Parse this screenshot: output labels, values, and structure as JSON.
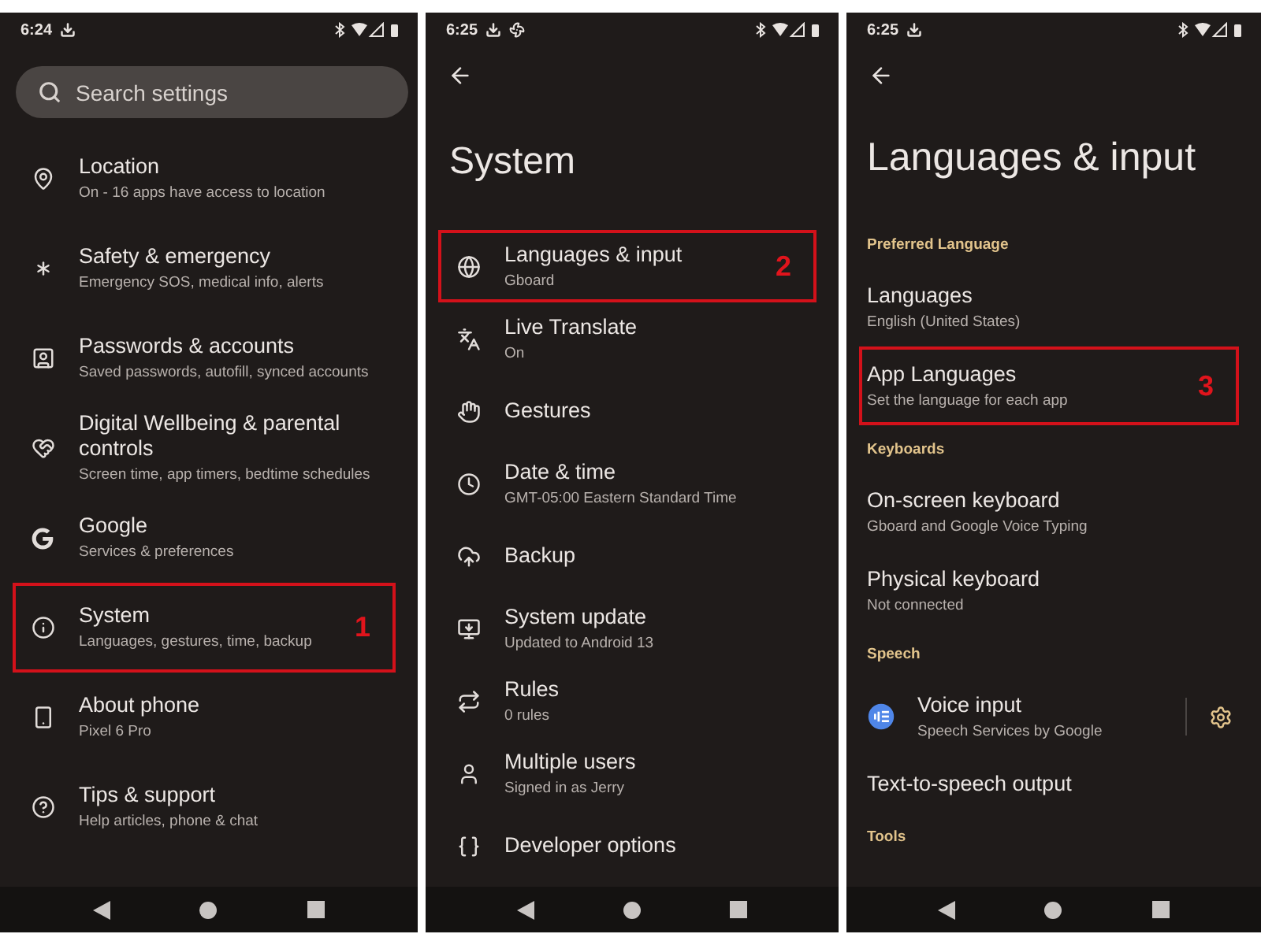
{
  "panels": [
    {
      "status_bar": {
        "time": "6:24",
        "notifications": [
          {
            "kind": "download"
          }
        ]
      },
      "search": {
        "placeholder": "Search settings"
      },
      "items": [
        {
          "kind": "entry",
          "title": "Location",
          "subtitle": "On - 16 apps have access to location"
        },
        {
          "kind": "entry",
          "title": "Safety & emergency",
          "subtitle": "Emergency SOS, medical info, alerts"
        },
        {
          "kind": "entry",
          "title": "Passwords & accounts",
          "subtitle": "Saved passwords, autofill, synced accounts"
        },
        {
          "kind": "entry",
          "title": "Digital Wellbeing & parental controls",
          "subtitle": "Screen time, app timers, bedtime schedules"
        },
        {
          "kind": "entry",
          "title": "Google",
          "subtitle": "Services & preferences"
        },
        {
          "kind": "entry",
          "title": "System",
          "subtitle": "Languages, gestures, time, backup",
          "callout": "1"
        },
        {
          "kind": "entry",
          "title": "About phone",
          "subtitle": "Pixel 6 Pro"
        },
        {
          "kind": "entry",
          "title": "Tips & support",
          "subtitle": "Help articles, phone & chat"
        }
      ]
    },
    {
      "status_bar": {
        "time": "6:25",
        "notifications": [
          {
            "kind": "download"
          },
          {
            "kind": "fan"
          }
        ]
      },
      "title": "System",
      "items": [
        {
          "kind": "entry",
          "title": "Languages & input",
          "subtitle": "Gboard",
          "callout": "2"
        },
        {
          "kind": "entry",
          "title": "Live Translate",
          "subtitle": "On"
        },
        {
          "kind": "entry",
          "title": "Gestures"
        },
        {
          "kind": "entry",
          "title": "Date & time",
          "subtitle": "GMT-05:00 Eastern Standard Time"
        },
        {
          "kind": "entry",
          "title": "Backup"
        },
        {
          "kind": "entry",
          "title": "System update",
          "subtitle": "Updated to Android 13"
        },
        {
          "kind": "entry",
          "title": "Rules",
          "subtitle": "0 rules"
        },
        {
          "kind": "entry",
          "title": "Multiple users",
          "subtitle": "Signed in as Jerry"
        },
        {
          "kind": "entry",
          "title": "Developer options"
        }
      ]
    },
    {
      "status_bar": {
        "time": "6:25",
        "notifications": [
          {
            "kind": "download"
          }
        ]
      },
      "title": "Languages & input",
      "items": [
        {
          "kind": "section",
          "title": "Preferred Language"
        },
        {
          "kind": "entry",
          "title": "Languages",
          "subtitle": "English (United States)"
        },
        {
          "kind": "entry",
          "title": "App Languages",
          "subtitle": "Set the language for each app",
          "callout": "3"
        },
        {
          "kind": "section",
          "title": "Keyboards"
        },
        {
          "kind": "entry",
          "title": "On-screen keyboard",
          "subtitle": "Gboard and Google Voice Typing"
        },
        {
          "kind": "entry",
          "title": "Physical keyboard",
          "subtitle": "Not connected"
        },
        {
          "kind": "section",
          "title": "Speech"
        },
        {
          "kind": "entry-settings",
          "title": "Voice input",
          "subtitle": "Speech Services by Google"
        },
        {
          "kind": "entry",
          "title": "Text-to-speech output"
        },
        {
          "kind": "section",
          "title": "Tools"
        }
      ]
    }
  ]
}
